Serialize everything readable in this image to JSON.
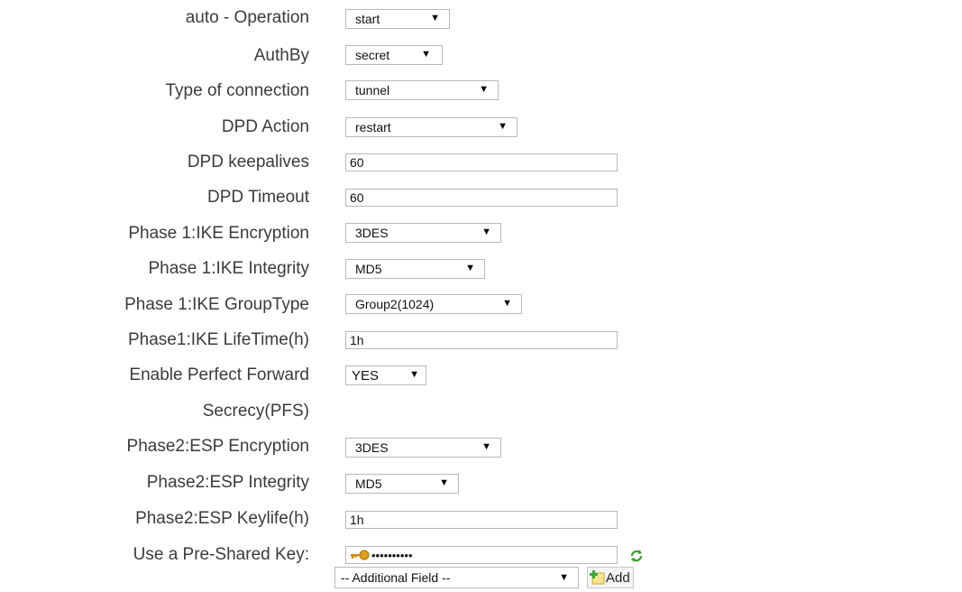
{
  "form": {
    "auto_operation": {
      "label": "auto - Operation",
      "value": "start"
    },
    "auth_by": {
      "label": "AuthBy",
      "value": "secret"
    },
    "connection_type": {
      "label": "Type of connection",
      "value": "tunnel"
    },
    "dpd_action": {
      "label": "DPD Action",
      "value": "restart"
    },
    "dpd_keepalives": {
      "label": "DPD keepalives",
      "value": "60"
    },
    "dpd_timeout": {
      "label": "DPD Timeout",
      "value": "60"
    },
    "p1_encryption": {
      "label": "Phase 1:IKE Encryption",
      "value": "3DES"
    },
    "p1_integrity": {
      "label": "Phase 1:IKE Integrity",
      "value": "MD5"
    },
    "p1_grouptype": {
      "label": "Phase 1:IKE GroupType",
      "value": "Group2(1024)"
    },
    "p1_lifetime": {
      "label": "Phase1:IKE LifeTime(h)",
      "value": "1h"
    },
    "pfs": {
      "label_line1": "Enable Perfect Forward",
      "label_line2": "Secrecy(PFS)",
      "value": "YES"
    },
    "p2_encryption": {
      "label": "Phase2:ESP Encryption",
      "value": "3DES"
    },
    "p2_integrity": {
      "label": "Phase2:ESP Integrity",
      "value": "MD5"
    },
    "p2_keylife": {
      "label": "Phase2:ESP Keylife(h)",
      "value": "1h"
    },
    "psk": {
      "label": "Use a Pre-Shared Key:",
      "value": "••••••••••"
    },
    "additional_field": {
      "value": "-- Additional Field --"
    },
    "add_button": {
      "label": "Add"
    }
  },
  "icons": {
    "dropdown": "chevron-down-icon",
    "key": "key-icon",
    "refresh": "refresh-icon",
    "add": "add-icon"
  },
  "colors": {
    "text": "#3b3b3b",
    "border": "#b9b9b9",
    "key": "#e0a020",
    "refresh": "#3a9a2a"
  }
}
